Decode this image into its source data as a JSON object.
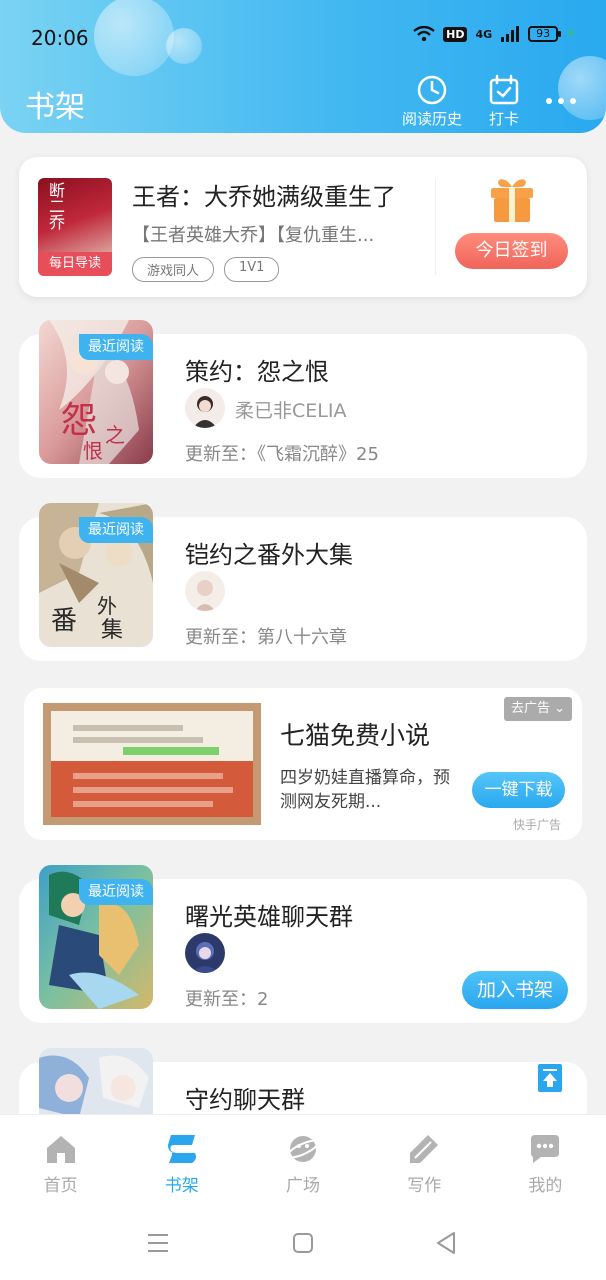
{
  "status_bar": {
    "time": "20:06",
    "hd": "HD",
    "network": "4G",
    "battery": "93"
  },
  "header": {
    "title": "书架",
    "history_label": "阅读历史",
    "checkin_label": "打卡"
  },
  "featured": {
    "cover_text": "断二乔",
    "cover_tag": "每日导读",
    "title": "王者：大乔她满级重生了",
    "description": "【王者英雄大乔】【复仇重生...",
    "tags": [
      "游戏同人",
      "1V1"
    ],
    "checkin_button": "今日签到"
  },
  "books": [
    {
      "tag": "最近阅读",
      "title": "策约：怨之恨",
      "author": "柔已非CELIA",
      "update": "更新至：《飞霜沉醉》25"
    },
    {
      "tag": "最近阅读",
      "title": "铠约之番外大集",
      "author": "",
      "update": "更新至：第八十六章"
    },
    {
      "tag": "最近阅读",
      "title": "曙光英雄聊天群",
      "author": "",
      "update": "更新至：2",
      "action": "加入书架"
    },
    {
      "title": "守约聊天群"
    }
  ],
  "ad": {
    "title": "七猫免费小说",
    "description": "四岁奶娃直播算命，预测网友死期...",
    "remove_label": "去广告",
    "download_label": "一键下载",
    "source": "快手广告"
  },
  "tabs": [
    {
      "label": "首页",
      "active": false
    },
    {
      "label": "书架",
      "active": true
    },
    {
      "label": "广场",
      "active": false
    },
    {
      "label": "写作",
      "active": false
    },
    {
      "label": "我的",
      "active": false
    }
  ],
  "colors": {
    "accent": "#2aa6ee",
    "header_start": "#7ad3f3",
    "checkin": "#f0645a"
  }
}
